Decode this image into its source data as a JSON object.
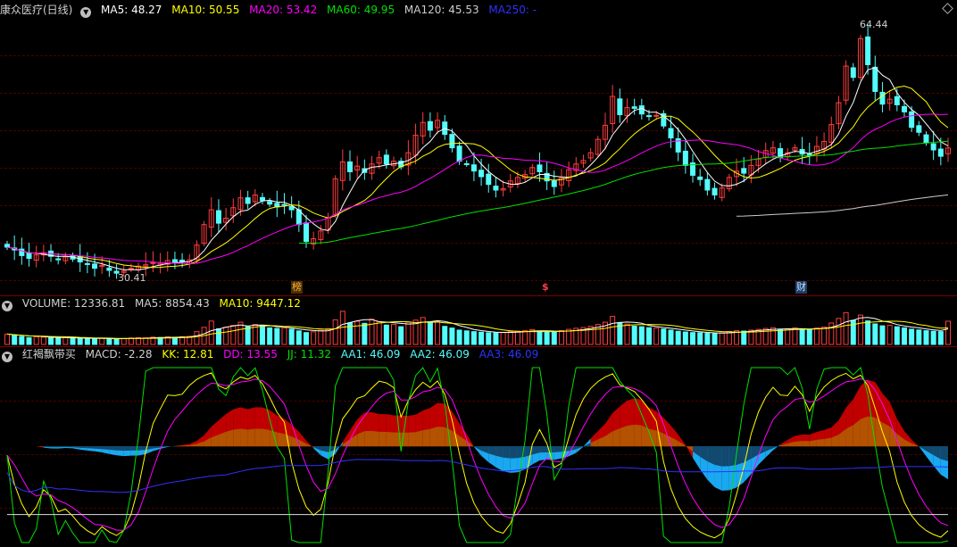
{
  "main_legend": {
    "title": "康众医疗(日线)",
    "ma5": "MA5: 48.27",
    "ma10": "MA10: 50.55",
    "ma20": "MA20: 53.42",
    "ma60": "MA60: 49.95",
    "ma120": "MA120: 45.53",
    "ma250": "MA250: -"
  },
  "price_annotations": {
    "high": "64.44",
    "low": "30.41"
  },
  "event_tags": {
    "bang": "榜",
    "dollar": "$",
    "cai": "财"
  },
  "volume_legend": {
    "volume": "VOLUME: 12336.81",
    "ma5": "MA5: 8854.43",
    "ma10": "MA10: 9447.12"
  },
  "indicator_legend": {
    "name": "红褐飘带买",
    "macd": "MACD: -2.28",
    "kk": "KK: 12.81",
    "dd": "DD: 13.55",
    "jj": "JJ: 11.32",
    "aa1": "AA1: 46.09",
    "aa2": "AA2: 46.09",
    "aa3": "AA3: 46.09"
  },
  "colors": {
    "up": "#ff3c3c",
    "down": "#54fcfc",
    "ma5": "#ffffff",
    "ma10": "#ffff00",
    "ma20": "#ff00ff",
    "ma60": "#00e000",
    "ma120": "#cccccc",
    "ma250": "#3030ff"
  },
  "chart_data": {
    "type": "candlestick",
    "price_range": [
      29,
      67
    ],
    "closes": [
      34.2,
      33.8,
      33.0,
      32.6,
      33.1,
      33.4,
      32.9,
      32.4,
      32.8,
      32.5,
      32.1,
      31.8,
      31.2,
      31.6,
      30.9,
      30.5,
      30.8,
      31.2,
      31.5,
      31.7,
      32.0,
      31.9,
      32.3,
      32.0,
      32.1,
      32.4,
      34.5,
      37.4,
      39.5,
      37.6,
      38.3,
      39.8,
      41.2,
      40.4,
      41.6,
      40.8,
      40.3,
      39.9,
      40.2,
      39.5,
      37.4,
      35.0,
      35.4,
      36.5,
      38.4,
      43.9,
      46.3,
      44.9,
      45.7,
      44.8,
      46.0,
      46.9,
      46.0,
      46.4,
      45.6,
      47.6,
      50.1,
      51.9,
      50.8,
      52.2,
      50.2,
      48.3,
      46.4,
      46.0,
      45.0,
      44.2,
      43.1,
      42.3,
      42.5,
      43.6,
      44.1,
      44.5,
      45.5,
      44.9,
      43.6,
      42.8,
      44.0,
      45.2,
      46.0,
      46.5,
      47.6,
      49.5,
      51.5,
      55.6,
      53.0,
      54.0,
      53.9,
      53.1,
      52.8,
      52.9,
      51.4,
      49.7,
      47.7,
      45.8,
      44.4,
      43.8,
      42.3,
      41.6,
      42.6,
      44.1,
      45.0,
      44.7,
      45.8,
      46.7,
      47.9,
      48.3,
      46.9,
      47.6,
      48.3,
      47.4,
      47.2,
      48.5,
      49.2,
      51.6,
      54.7,
      59.9,
      58.3,
      63.8,
      60.1,
      56.3,
      54.5,
      55.2,
      54.4,
      53.4,
      51.2,
      50.5,
      49.0,
      48.0,
      47.1,
      48.27
    ],
    "volumes": [
      5500,
      4800,
      4200,
      3600,
      4100,
      3900,
      3500,
      3300,
      3600,
      3400,
      3200,
      3100,
      3000,
      3300,
      3100,
      2900,
      3100,
      3400,
      3600,
      3500,
      3900,
      3700,
      4000,
      3800,
      4100,
      4300,
      6800,
      9100,
      12400,
      8300,
      9200,
      10100,
      11800,
      9400,
      10600,
      9800,
      8800,
      8500,
      8700,
      8100,
      7200,
      6300,
      6700,
      7500,
      8400,
      13100,
      17600,
      11400,
      12300,
      11200,
      13400,
      12100,
      10300,
      10700,
      9400,
      11800,
      12900,
      14300,
      11900,
      12100,
      9600,
      8700,
      7600,
      7200,
      6800,
      6500,
      6200,
      6100,
      6300,
      6800,
      7100,
      7400,
      7900,
      7100,
      6700,
      6400,
      7300,
      8000,
      8600,
      9000,
      9600,
      10600,
      11800,
      14900,
      11400,
      10800,
      9700,
      9400,
      8900,
      8700,
      8200,
      7600,
      7000,
      6600,
      6300,
      6200,
      5900,
      5700,
      6200,
      6900,
      7300,
      7100,
      7600,
      8000,
      8500,
      8900,
      7800,
      8200,
      8700,
      8100,
      7900,
      8700,
      9200,
      11400,
      13800,
      16900,
      12800,
      15600,
      12500,
      10900,
      9900,
      10100,
      9400,
      8800,
      8100,
      7700,
      7300,
      7000,
      6800,
      12336.81
    ],
    "indicator": {
      "macd_current": -2.28,
      "kk_current": 12.81,
      "dd_current": 13.55,
      "jj_current": 11.32,
      "aa_current": 46.09
    }
  }
}
